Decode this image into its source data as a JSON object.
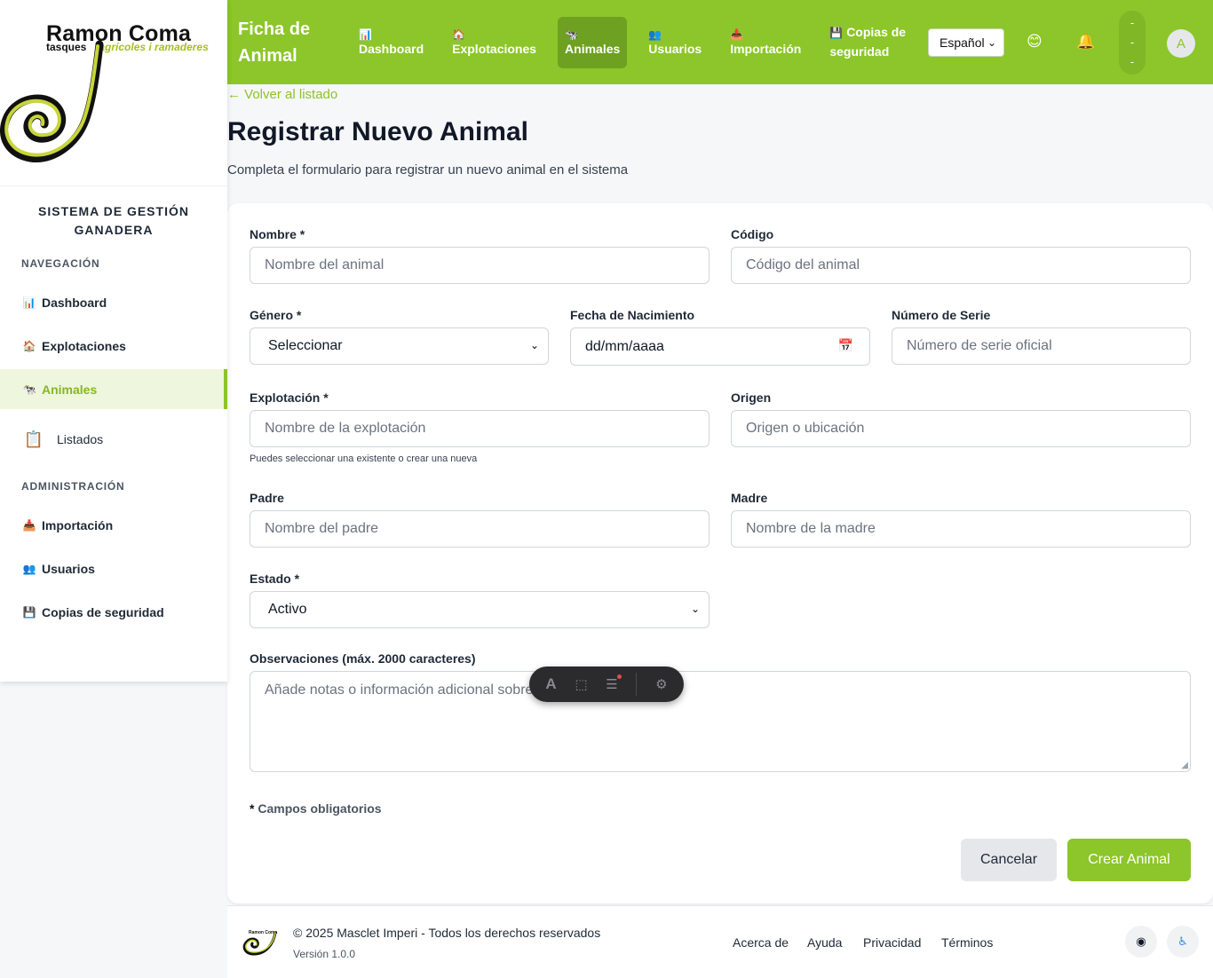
{
  "brand": {
    "name": "Ramon Coma",
    "sub_left": "tasques",
    "sub_right": "agrícoles i ramaderes"
  },
  "sidebar": {
    "system_title": "SISTEMA DE GESTIÓN GANADERA",
    "nav_label": "NAVEGACIÓN",
    "nav_items": [
      {
        "label": "Dashboard",
        "icon": "📊"
      },
      {
        "label": "Explotaciones",
        "icon": "🏠"
      },
      {
        "label": "Animales",
        "icon": "🐄"
      },
      {
        "label": "Listados",
        "icon": "📋"
      }
    ],
    "admin_label": "ADMINISTRACIÓN",
    "admin_items": [
      {
        "label": "Importación",
        "icon": "📥"
      },
      {
        "label": "Usuarios",
        "icon": "👥"
      },
      {
        "label": "Copias de seguridad",
        "icon": "💾"
      }
    ]
  },
  "header": {
    "title": "Ficha de Animal",
    "nav": [
      {
        "label": "Dashboard",
        "icon": "📊"
      },
      {
        "label": "Explotaciones",
        "icon": "🏠"
      },
      {
        "label": "Animales",
        "icon": "🐄"
      },
      {
        "label": "Usuarios",
        "icon": "👥"
      },
      {
        "label": "Importación",
        "icon": "📥"
      },
      {
        "label": "Copias de seguridad",
        "icon": "💾"
      }
    ],
    "language": "Español",
    "emoji_icon": "😊",
    "bell_icon": "🔔",
    "pill_dashes": [
      "-",
      "-",
      "-"
    ],
    "avatar_letter": "A"
  },
  "page": {
    "back_link": "← Volver al listado",
    "title": "Registrar Nuevo Animal",
    "subtitle": "Completa el formulario para registrar un nuevo animal en el sistema"
  },
  "form": {
    "nombre": {
      "label": "Nombre *",
      "placeholder": "Nombre del animal"
    },
    "codigo": {
      "label": "Código",
      "placeholder": "Código del animal"
    },
    "genero": {
      "label": "Género *",
      "value": "Seleccionar"
    },
    "fecha": {
      "label": "Fecha de Nacimiento",
      "value": "dd/mm/aaaa"
    },
    "serie": {
      "label": "Número de Serie",
      "placeholder": "Número de serie oficial"
    },
    "explotacion": {
      "label": "Explotación *",
      "placeholder": "Nombre de la explotación",
      "hint": "Puedes seleccionar una existente o crear una nueva"
    },
    "origen": {
      "label": "Origen",
      "placeholder": "Origen o ubicación"
    },
    "padre": {
      "label": "Padre",
      "placeholder": "Nombre del padre"
    },
    "madre": {
      "label": "Madre",
      "placeholder": "Nombre de la madre"
    },
    "estado": {
      "label": "Estado *",
      "value": "Activo"
    },
    "observaciones": {
      "label": "Observaciones (máx. 2000 caracteres)",
      "placeholder": "Añade notas o información adicional sobre el animal"
    },
    "required_star": "*",
    "required_note": "Campos obligatorios",
    "cancel": "Cancelar",
    "submit": "Crear Animal"
  },
  "footer": {
    "copyright": "© 2025 Masclet Imperi - Todos los derechos reservados",
    "version": "Versión 1.0.0",
    "links": [
      "Acerca de",
      "Ayuda",
      "Privacidad",
      "Términos"
    ],
    "mini_logo": "Ramon Coma"
  }
}
